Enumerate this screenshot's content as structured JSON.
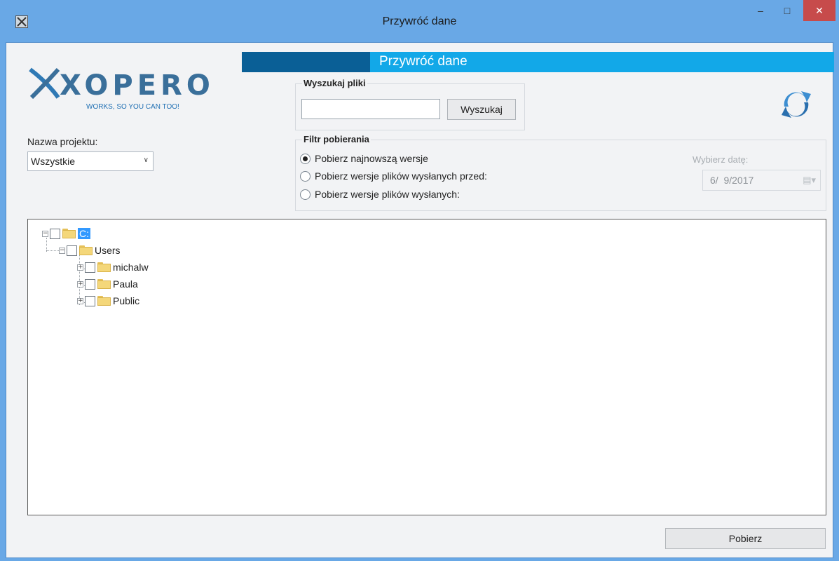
{
  "window": {
    "title": "Przywróć dane"
  },
  "banner": {
    "title": "Przywróć dane"
  },
  "logo": {
    "name": "XOPERO",
    "tagline": "WORKS, SO YOU CAN TOO!"
  },
  "project": {
    "label": "Nazwa projektu:",
    "selected": "Wszystkie"
  },
  "search": {
    "group_title": "Wyszukaj pliki",
    "value": "",
    "button_label": "Wyszukaj"
  },
  "filter": {
    "group_title": "Filtr pobierania",
    "options": [
      {
        "label": "Pobierz najnowszą wersje",
        "checked": true
      },
      {
        "label": "Pobierz wersje plików wysłanych przed:",
        "checked": false
      },
      {
        "label": "Pobierz wersje plików wysłanych:",
        "checked": false
      }
    ],
    "date_label": "Wybierz datę:",
    "date_value": "6/  9/2017"
  },
  "tree": {
    "root": "C:",
    "children": [
      {
        "label": "Users",
        "children": [
          "michalw",
          "Paula",
          "Public"
        ]
      }
    ]
  },
  "actions": {
    "download_label": "Pobierz"
  },
  "colors": {
    "titlebar": "#69a8e6",
    "banner": "#12a8e8",
    "banner_dark": "#0a5f96",
    "close": "#c74b4b",
    "selection": "#3399ff"
  }
}
